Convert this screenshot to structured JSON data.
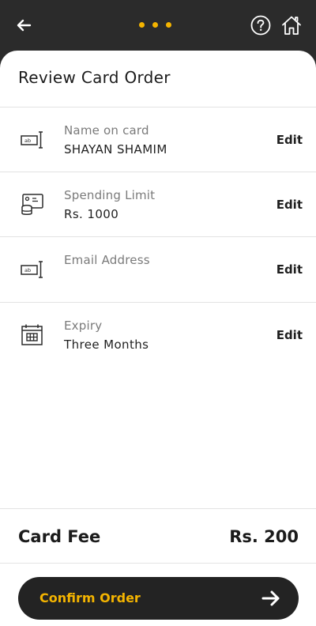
{
  "header": {
    "back_icon": "arrow-left-icon",
    "help_icon": "question-circle-icon",
    "home_icon": "home-icon",
    "accent_color": "#f4b400",
    "bar_color": "#2b2b2b"
  },
  "page": {
    "title": "Review Card Order"
  },
  "rows": [
    {
      "label": "Name on card",
      "value": "SHAYAN SHAMIM",
      "edit": "Edit",
      "icon": "text-field-icon"
    },
    {
      "label": "Spending Limit",
      "value": "Rs. 1000",
      "edit": "Edit",
      "icon": "money-limit-icon"
    },
    {
      "label": "Email Address",
      "value": "",
      "edit": "Edit",
      "icon": "text-field-icon"
    },
    {
      "label": "Expiry",
      "value": "Three Months",
      "edit": "Edit",
      "icon": "calendar-icon"
    }
  ],
  "fee": {
    "label": "Card Fee",
    "value": "Rs. 200"
  },
  "confirm": {
    "label": "Confirm Order",
    "icon": "arrow-right-icon"
  }
}
